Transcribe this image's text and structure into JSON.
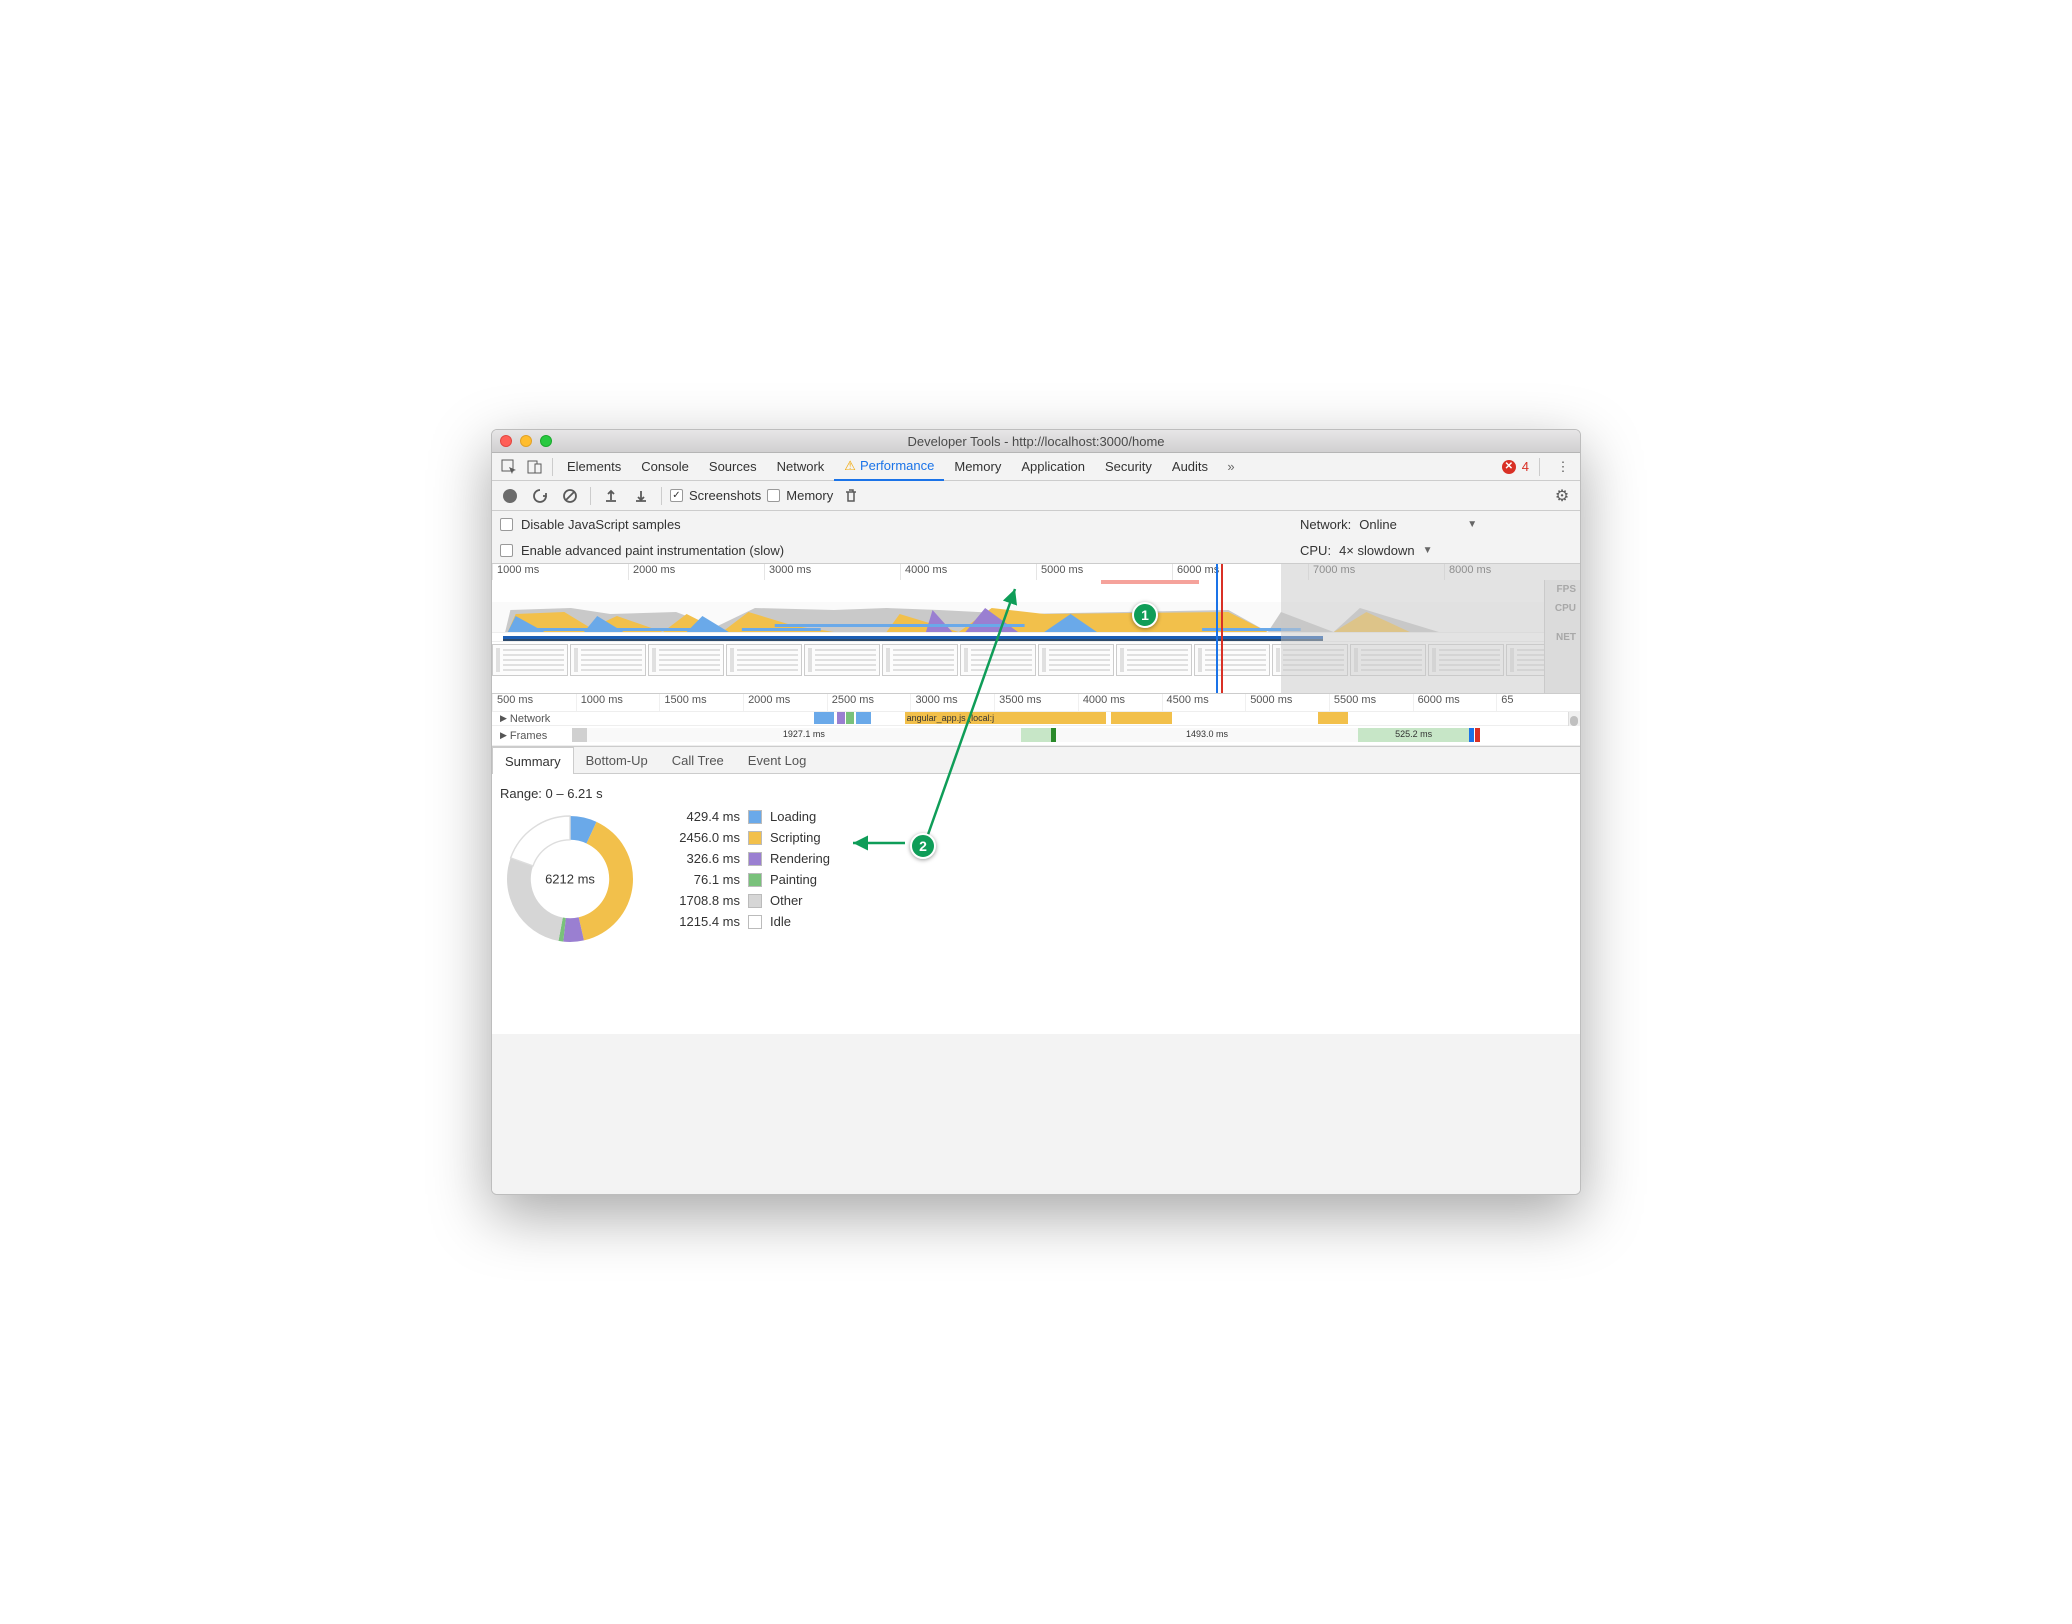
{
  "window": {
    "title": "Developer Tools - http://localhost:3000/home"
  },
  "tabs": {
    "items": [
      "Elements",
      "Console",
      "Sources",
      "Network",
      "Performance",
      "Memory",
      "Application",
      "Security",
      "Audits"
    ],
    "active_index": 4
  },
  "errors": {
    "count": "4"
  },
  "toolbar": {
    "screenshots_label": "Screenshots",
    "screenshots_checked": true,
    "memory_label": "Memory",
    "memory_checked": false
  },
  "options": {
    "disable_js_label": "Disable JavaScript samples",
    "disable_js_checked": false,
    "advanced_paint_label": "Enable advanced paint instrumentation (slow)",
    "advanced_paint_checked": false,
    "network_label": "Network:",
    "network_value": "Online",
    "cpu_label": "CPU:",
    "cpu_value": "4× slowdown"
  },
  "overview": {
    "ticks": [
      "1000 ms",
      "2000 ms",
      "3000 ms",
      "4000 ms",
      "5000 ms",
      "6000 ms",
      "7000 ms",
      "8000 ms"
    ],
    "labels": {
      "fps": "FPS",
      "cpu": "CPU",
      "net": "NET"
    }
  },
  "detail": {
    "ticks": [
      "500 ms",
      "1000 ms",
      "1500 ms",
      "2000 ms",
      "2500 ms",
      "3000 ms",
      "3500 ms",
      "4000 ms",
      "4500 ms",
      "5000 ms",
      "5500 ms",
      "6000 ms",
      "65"
    ],
    "network_label": "Network",
    "frames_label": "Frames",
    "frame_times": [
      "1927.1 ms",
      "1493.0 ms",
      "525.2 ms"
    ],
    "flame_label": "angular_app.js (local:j"
  },
  "detail_tabs": {
    "items": [
      "Summary",
      "Bottom-Up",
      "Call Tree",
      "Event Log"
    ],
    "active_index": 0
  },
  "summary": {
    "range_text": "Range: 0 – 6.21 s",
    "total": "6212 ms",
    "legend": [
      {
        "ms": "429.4 ms",
        "label": "Loading",
        "color": "#6aa9e9"
      },
      {
        "ms": "2456.0 ms",
        "label": "Scripting",
        "color": "#f2c04b"
      },
      {
        "ms": "326.6 ms",
        "label": "Rendering",
        "color": "#9a7fd1"
      },
      {
        "ms": "76.1 ms",
        "label": "Painting",
        "color": "#79c17b"
      },
      {
        "ms": "1708.8 ms",
        "label": "Other",
        "color": "#d6d6d6"
      },
      {
        "ms": "1215.4 ms",
        "label": "Idle",
        "color": "#ffffff"
      }
    ]
  },
  "annotations": {
    "a1": "1",
    "a2": "2"
  },
  "chart_data": {
    "type": "pie",
    "title": "Performance Summary (donut)",
    "total_ms": 6212,
    "series": [
      {
        "name": "Loading",
        "value": 429.4,
        "color": "#6aa9e9"
      },
      {
        "name": "Scripting",
        "value": 2456.0,
        "color": "#f2c04b"
      },
      {
        "name": "Rendering",
        "value": 326.6,
        "color": "#9a7fd1"
      },
      {
        "name": "Painting",
        "value": 76.1,
        "color": "#79c17b"
      },
      {
        "name": "Other",
        "value": 1708.8,
        "color": "#d6d6d6"
      },
      {
        "name": "Idle",
        "value": 1215.4,
        "color": "#ffffff"
      }
    ]
  }
}
